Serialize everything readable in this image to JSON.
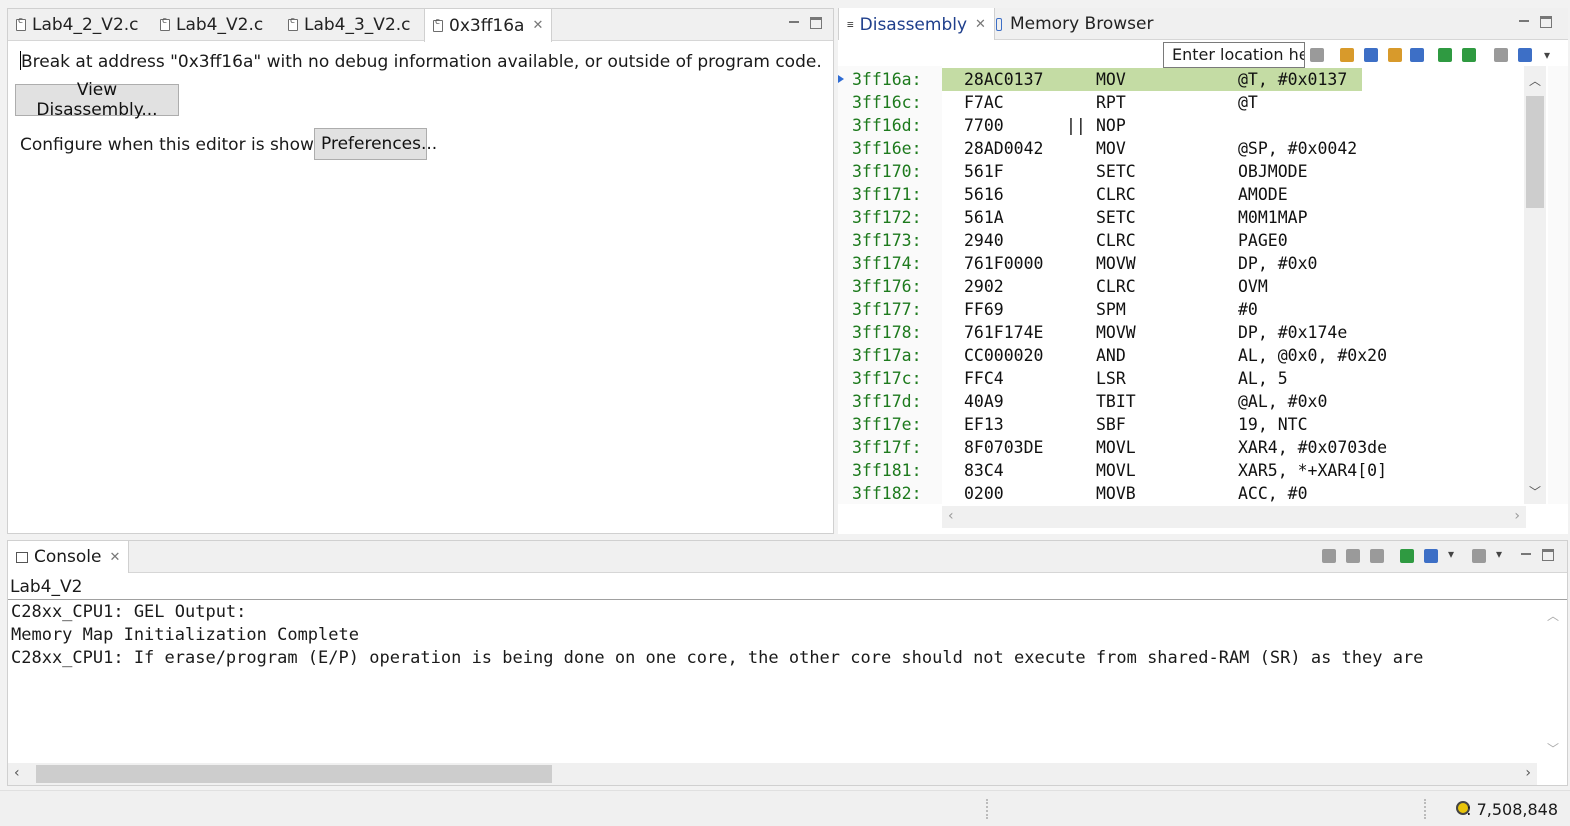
{
  "editor": {
    "tabs": [
      {
        "label": "Lab4_2_V2.c"
      },
      {
        "label": "Lab4_V2.c"
      },
      {
        "label": "Lab4_3_V2.c"
      },
      {
        "label": "0x3ff16a"
      }
    ],
    "message": "Break at address \"0x3ff16a\" with no debug information available, or outside of program code.",
    "view_button": "View Disassembly...",
    "configure_text": "Configure when this editor is shown",
    "preferences_button": "Preferences..."
  },
  "disassembly": {
    "tabs": [
      {
        "label": "Disassembly"
      },
      {
        "label": "Memory Browser"
      }
    ],
    "location_placeholder": "Enter location he",
    "lines": [
      {
        "addr": "3ff16a:",
        "op": "28AC0137",
        "sep": "",
        "mn": "MOV",
        "args": "@T, #0x0137"
      },
      {
        "addr": "3ff16c:",
        "op": "F7AC",
        "sep": "",
        "mn": "RPT",
        "args": "@T"
      },
      {
        "addr": "3ff16d:",
        "op": "7700",
        "sep": "||",
        "mn": "NOP",
        "args": ""
      },
      {
        "addr": "3ff16e:",
        "op": "28AD0042",
        "sep": "",
        "mn": "MOV",
        "args": "@SP, #0x0042"
      },
      {
        "addr": "3ff170:",
        "op": "561F",
        "sep": "",
        "mn": "SETC",
        "args": "OBJMODE"
      },
      {
        "addr": "3ff171:",
        "op": "5616",
        "sep": "",
        "mn": "CLRC",
        "args": "AMODE"
      },
      {
        "addr": "3ff172:",
        "op": "561A",
        "sep": "",
        "mn": "SETC",
        "args": "M0M1MAP"
      },
      {
        "addr": "3ff173:",
        "op": "2940",
        "sep": "",
        "mn": "CLRC",
        "args": "PAGE0"
      },
      {
        "addr": "3ff174:",
        "op": "761F0000",
        "sep": "",
        "mn": "MOVW",
        "args": "DP, #0x0"
      },
      {
        "addr": "3ff176:",
        "op": "2902",
        "sep": "",
        "mn": "CLRC",
        "args": "OVM"
      },
      {
        "addr": "3ff177:",
        "op": "FF69",
        "sep": "",
        "mn": "SPM",
        "args": "#0"
      },
      {
        "addr": "3ff178:",
        "op": "761F174E",
        "sep": "",
        "mn": "MOVW",
        "args": "DP, #0x174e"
      },
      {
        "addr": "3ff17a:",
        "op": "CC000020",
        "sep": "",
        "mn": "AND",
        "args": "AL, @0x0, #0x20"
      },
      {
        "addr": "3ff17c:",
        "op": "FFC4",
        "sep": "",
        "mn": "LSR",
        "args": "AL, 5"
      },
      {
        "addr": "3ff17d:",
        "op": "40A9",
        "sep": "",
        "mn": "TBIT",
        "args": "@AL, #0x0"
      },
      {
        "addr": "3ff17e:",
        "op": "EF13",
        "sep": "",
        "mn": "SBF",
        "args": "19, NTC"
      },
      {
        "addr": "3ff17f:",
        "op": "8F0703DE",
        "sep": "",
        "mn": "MOVL",
        "args": "XAR4, #0x0703de"
      },
      {
        "addr": "3ff181:",
        "op": "83C4",
        "sep": "",
        "mn": "MOVL",
        "args": "XAR5, *+XAR4[0]"
      },
      {
        "addr": "3ff182:",
        "op": "0200",
        "sep": "",
        "mn": "MOVB",
        "args": "ACC, #0"
      }
    ]
  },
  "console": {
    "tab_label": "Console",
    "session_name": "Lab4_V2",
    "lines": [
      "C28xx_CPU1: GEL Output:",
      "Memory Map Initialization Complete",
      "C28xx_CPU1: If erase/program (E/P) operation is being done on one core, the other core should not execute from shared-RAM (SR) as they are"
    ]
  },
  "status": {
    "cycle_count": ": 7,508,848"
  }
}
